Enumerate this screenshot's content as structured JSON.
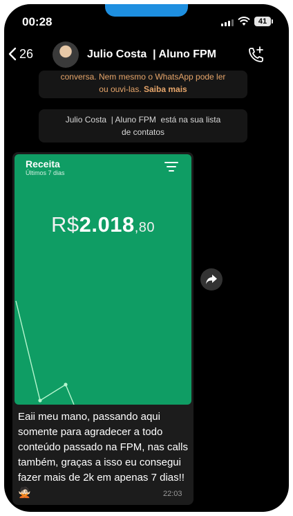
{
  "status": {
    "time": "00:28",
    "battery": "41"
  },
  "header": {
    "back_count": "26",
    "contact_name": "Julio Costa",
    "contact_role": "| Aluno FPM"
  },
  "system": {
    "encryption_line1": "conversa. Nem mesmo o WhatsApp pode ler",
    "encryption_line2": "ou ouvi-las.",
    "encryption_link": "Saiba mais",
    "contact_note_line1": "Julio Costa  | Aluno FPM  está na sua lista",
    "contact_note_line2": "de contatos"
  },
  "image": {
    "title": "Receita",
    "subtitle": "Últimos 7 dias",
    "currency": "R$",
    "amount": "2.018",
    "cents": ",80"
  },
  "message": {
    "text": "Eaii meu mano, passando aqui somente para agradecer a todo conteúdo passado  na FPM, nas calls também, graças a isso eu consegui fazer mais de 2k em apenas 7 dias!! 🙅🏻",
    "time": "22:03"
  },
  "colors": {
    "accent": "#0f9d64",
    "bubble": "#1c1c1c",
    "system_text": "#e6a56a"
  },
  "icons": {
    "back": "chevron-left-icon",
    "call": "add-call-icon",
    "filter": "filter-icon",
    "share": "share-icon"
  }
}
